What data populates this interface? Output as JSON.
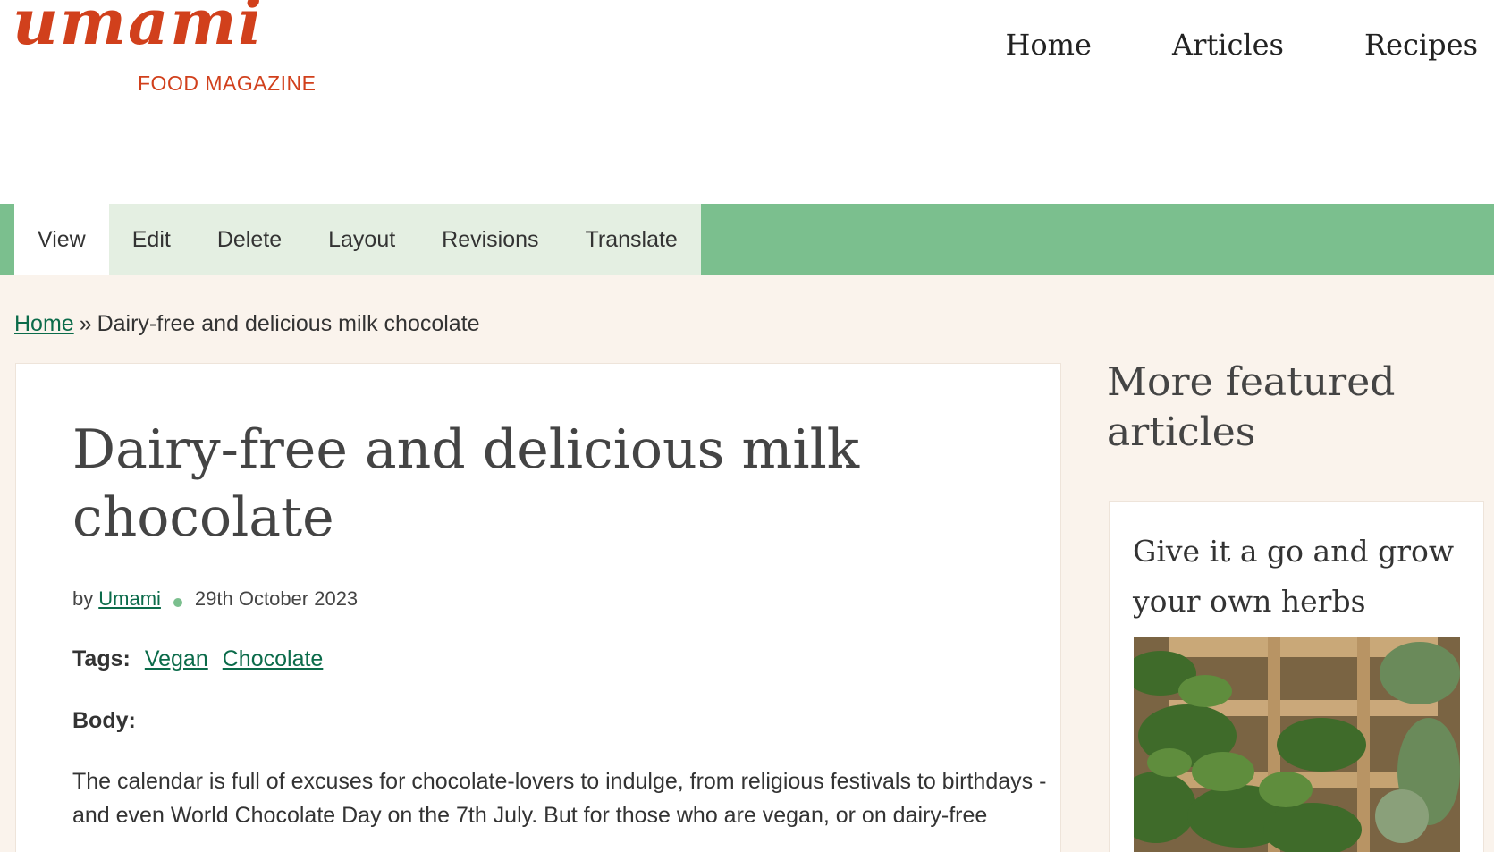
{
  "site": {
    "logo_word": "umami",
    "logo_sub": "FOOD MAGAZINE",
    "brand_color": "#d1401c"
  },
  "nav": {
    "items": [
      {
        "label": "Home"
      },
      {
        "label": "Articles"
      },
      {
        "label": "Recipes"
      }
    ]
  },
  "tabs": {
    "items": [
      {
        "label": "View",
        "active": true
      },
      {
        "label": "Edit"
      },
      {
        "label": "Delete"
      },
      {
        "label": "Layout"
      },
      {
        "label": "Revisions"
      },
      {
        "label": "Translate"
      }
    ],
    "bar_color": "#7bbf8e"
  },
  "breadcrumb": {
    "home": "Home",
    "separator": "»",
    "current": "Dairy-free and delicious milk chocolate"
  },
  "article": {
    "title": "Dairy-free and delicious milk chocolate",
    "by": "by",
    "author": "Umami",
    "date": "29th October 2023",
    "tags_label": "Tags:",
    "tags": [
      "Vegan",
      "Chocolate"
    ],
    "body_label": "Body:",
    "body_text": "The calendar is full of excuses for chocolate-lovers to indulge, from religious festivals to birthdays - and even World Chocolate Day on the 7th July. But for those who are vegan, or on dairy-free"
  },
  "sidebar": {
    "title": "More featured articles",
    "feature_title": "Give it a go and grow your own herbs"
  }
}
